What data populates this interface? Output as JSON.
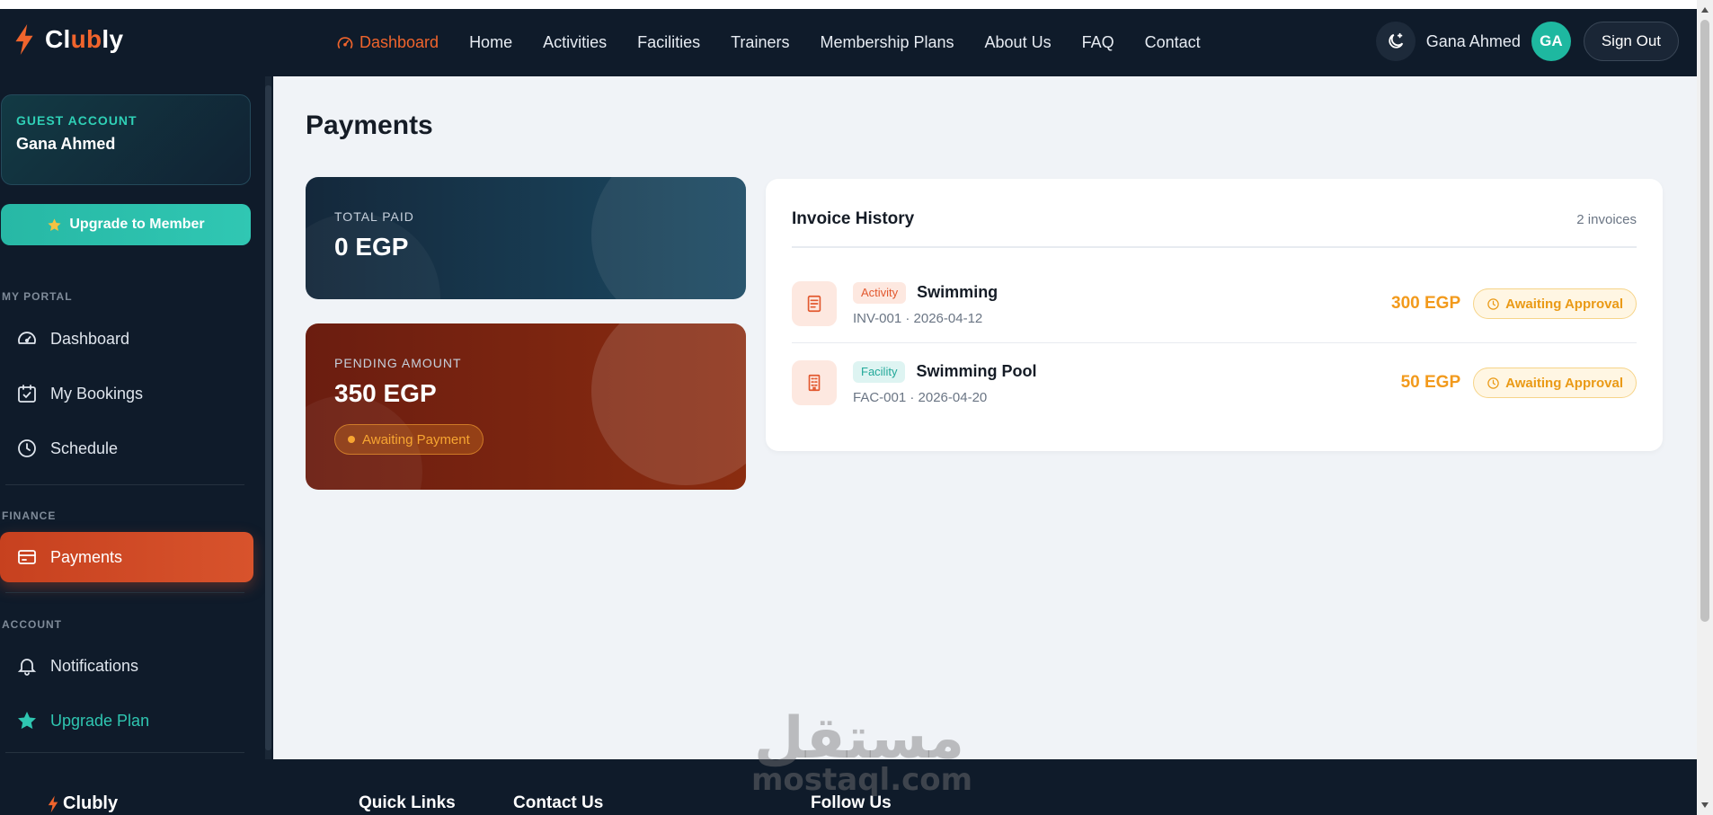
{
  "brand": {
    "name_pre": "Cl",
    "name_accent": "ub",
    "name_post": "ly",
    "accent_color": "#f0642c"
  },
  "nav": {
    "links": [
      {
        "label": "Dashboard"
      },
      {
        "label": "Home"
      },
      {
        "label": "Activities"
      },
      {
        "label": "Facilities"
      },
      {
        "label": "Trainers"
      },
      {
        "label": "Membership Plans"
      },
      {
        "label": "About Us"
      },
      {
        "label": "FAQ"
      },
      {
        "label": "Contact"
      }
    ],
    "user_name": "Gana Ahmed",
    "avatar_initials": "GA",
    "sign_out": "Sign Out"
  },
  "sidebar": {
    "account_type": "GUEST ACCOUNT",
    "account_name": "Gana Ahmed",
    "upgrade_button": "Upgrade to Member",
    "sections": {
      "portal": "MY PORTAL",
      "finance": "FINANCE",
      "account": "ACCOUNT"
    },
    "items": {
      "dashboard": "Dashboard",
      "bookings": "My Bookings",
      "schedule": "Schedule",
      "payments": "Payments",
      "notifications": "Notifications",
      "upgrade_plan": "Upgrade Plan"
    }
  },
  "main": {
    "title": "Payments",
    "total_paid": {
      "label": "TOTAL PAID",
      "value": "0 EGP"
    },
    "pending": {
      "label": "PENDING AMOUNT",
      "value": "350 EGP",
      "status": "Awaiting Payment"
    },
    "invoices": {
      "title": "Invoice History",
      "count": "2 invoices",
      "rows": [
        {
          "type": "Activity",
          "name": "Swimming",
          "meta": "INV-001 · 2026-04-12",
          "amount": "300 EGP",
          "status": "Awaiting Approval"
        },
        {
          "type": "Facility",
          "name": "Swimming Pool",
          "meta": "FAC-001 · 2026-04-20",
          "amount": "50 EGP",
          "status": "Awaiting Approval"
        }
      ]
    }
  },
  "footer": {
    "brand": "Clubly",
    "quick_links": "Quick Links",
    "contact_us": "Contact Us",
    "follow_us": "Follow Us"
  },
  "watermark": {
    "arabic": "مستقل",
    "latin": "mostaql.com"
  },
  "colors": {
    "nav_bg": "#0f1b2a",
    "accent_orange": "#f0642c",
    "teal": "#2fc6b1",
    "amount_orange": "#f29a1c"
  }
}
